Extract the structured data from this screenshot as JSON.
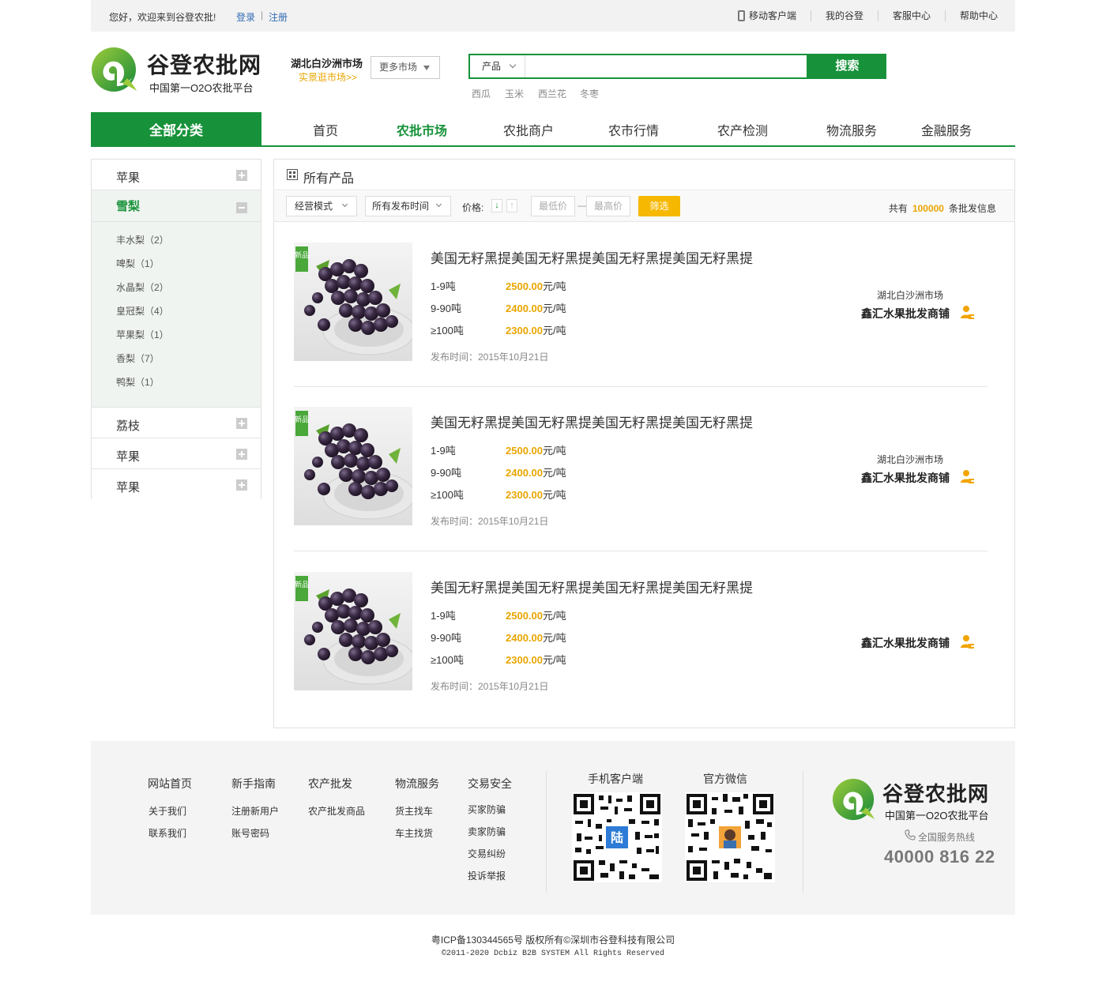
{
  "topbar": {
    "welcome": "您好，欢迎来到谷登农批!",
    "login": "登录",
    "separator": "|",
    "register": "注册",
    "links": [
      "移动客户端",
      "我的谷登",
      "客服中心",
      "帮助中心"
    ]
  },
  "header": {
    "logo_title": "谷登农批网",
    "logo_subtitle": "中国第一O2O农批平台",
    "market_name": "湖北白沙洲市场",
    "market_link": "实景逛市场>>",
    "more_market": "更多市场",
    "search_category": "产品",
    "search_placeholder": "",
    "search_button": "搜索",
    "hot_keywords": [
      "西瓜",
      "玉米",
      "西兰花",
      "冬枣"
    ]
  },
  "nav": {
    "all_categories": "全部分类",
    "items": [
      "首页",
      "农批市场",
      "农批商户",
      "农市行情",
      "农产检测",
      "物流服务",
      "金融服务"
    ],
    "active_index": 1
  },
  "sidebar": {
    "top": [
      {
        "label": "苹果"
      },
      {
        "label": "雪梨"
      }
    ],
    "sub_items": [
      "丰水梨（2）",
      "啤梨（1）",
      "水晶梨（2）",
      "皇冠梨（4）",
      "苹果梨（1）",
      "香梨（7）",
      "鸭梨（1）"
    ],
    "bottom": [
      {
        "label": "荔枝"
      },
      {
        "label": "苹果"
      },
      {
        "label": "苹果"
      }
    ]
  },
  "main": {
    "title": "所有产品",
    "filters": {
      "mode": "经营模式",
      "time": "所有发布时间",
      "price_label": "价格:",
      "sort_down": "↓",
      "sort_up": "↑",
      "min_price": "最低价",
      "dash": "—",
      "max_price": "最高价",
      "filter_button": "筛选"
    },
    "total": {
      "prefix": "共有",
      "count": "100000",
      "suffix": "条批发信息"
    },
    "products": [
      {
        "badge": "新品",
        "title": "美国无籽黑提美国无籽黑提美国无籽黑提美国无籽黑提",
        "tiers": [
          {
            "range": "1-9吨",
            "price": "2500.00",
            "unit": "元/吨"
          },
          {
            "range": "9-90吨",
            "price": "2400.00",
            "unit": "元/吨"
          },
          {
            "range": "≥100吨",
            "price": "2300.00",
            "unit": "元/吨"
          }
        ],
        "published": "发布时间：2015年10月21日",
        "market": "湖北白沙洲市场",
        "shop": "鑫汇水果批发商铺"
      },
      {
        "badge": "新品",
        "title": "美国无籽黑提美国无籽黑提美国无籽黑提美国无籽黑提",
        "tiers": [
          {
            "range": "1-9吨",
            "price": "2500.00",
            "unit": "元/吨"
          },
          {
            "range": "9-90吨",
            "price": "2400.00",
            "unit": "元/吨"
          },
          {
            "range": "≥100吨",
            "price": "2300.00",
            "unit": "元/吨"
          }
        ],
        "published": "发布时间：2015年10月21日",
        "market": "湖北白沙洲市场",
        "shop": "鑫汇水果批发商铺"
      },
      {
        "badge": "新品",
        "title": "美国无籽黑提美国无籽黑提美国无籽黑提美国无籽黑提",
        "tiers": [
          {
            "range": "1-9吨",
            "price": "2500.00",
            "unit": "元/吨"
          },
          {
            "range": "9-90吨",
            "price": "2400.00",
            "unit": "元/吨"
          },
          {
            "range": "≥100吨",
            "price": "2300.00",
            "unit": "元/吨"
          }
        ],
        "published": "发布时间：2015年10月21日",
        "market": "",
        "shop": "鑫汇水果批发商铺"
      }
    ]
  },
  "footer": {
    "columns": [
      {
        "title": "网站首页",
        "items": [
          "关于我们",
          "联系我们"
        ]
      },
      {
        "title": "新手指南",
        "items": [
          "注册新用户",
          "账号密码"
        ]
      },
      {
        "title": "农产批发",
        "items": [
          "农产批发商品"
        ]
      },
      {
        "title": "物流服务",
        "items": [
          "货主找车",
          "车主找货"
        ]
      },
      {
        "title": "交易安全",
        "items": [
          "买家防骗",
          "卖家防骗",
          "交易纠纷",
          "投诉举报"
        ]
      }
    ],
    "qr_app_label": "手机客户端",
    "qr_wechat_label": "官方微信",
    "logo_title": "谷登农批网",
    "logo_subtitle": "中国第一O2O农批平台",
    "hotline_label": "全国服务热线",
    "hotline": "40000 816 22"
  },
  "copyright": {
    "line1": "粤ICP备130344565号 版权所有©深圳市谷登科技有限公司",
    "line2": "©2011-2020 Dcbiz B2B SYSTEM All Rights Reserved"
  },
  "colors": {
    "brand_green": "#17923a",
    "accent_orange": "#e8a600",
    "filter_yellow": "#f6b800"
  }
}
